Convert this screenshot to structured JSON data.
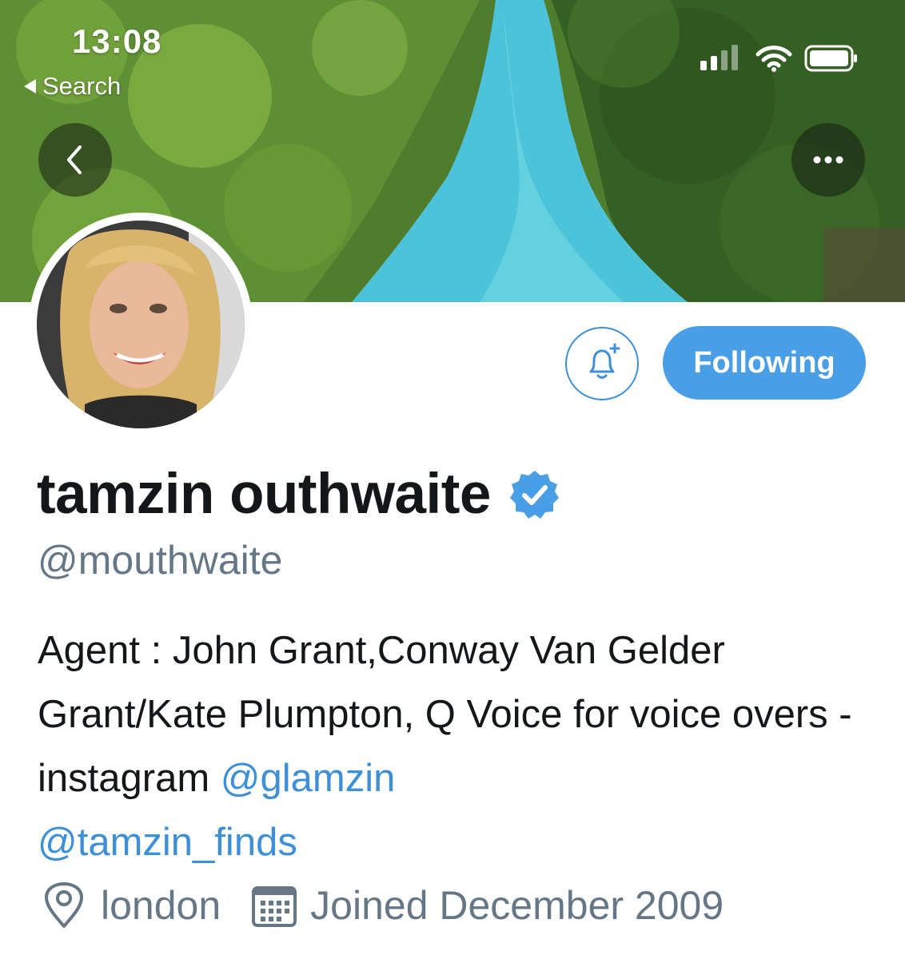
{
  "status_bar": {
    "time": "13:08",
    "back_app": "Search",
    "signal_icon": "cellular-signal-icon",
    "wifi_icon": "wifi-icon",
    "battery_icon": "battery-icon"
  },
  "banner": {
    "back_icon": "chevron-left-icon",
    "more_icon": "more-horizontal-icon"
  },
  "actions": {
    "notifications_icon": "bell-plus-icon",
    "follow_label": "Following"
  },
  "profile": {
    "display_name": "tamzin outhwaite",
    "verified_icon": "verified-badge-icon",
    "handle": "@mouthwaite",
    "bio": {
      "text_1": "Agent : John Grant,Conway Van Gelder Grant/Kate Plumpton, Q Voice for voice overs - instagram ",
      "mention_1": "@glamzin",
      "mention_2": "@tamzin_finds"
    },
    "location": "london",
    "location_icon": "location-pin-icon",
    "joined": "Joined December 2009",
    "joined_icon": "calendar-icon"
  },
  "colors": {
    "accent": "#4a9ee6",
    "link": "#3d8fd8",
    "secondary_text": "#657786",
    "primary_text": "#14171a"
  }
}
